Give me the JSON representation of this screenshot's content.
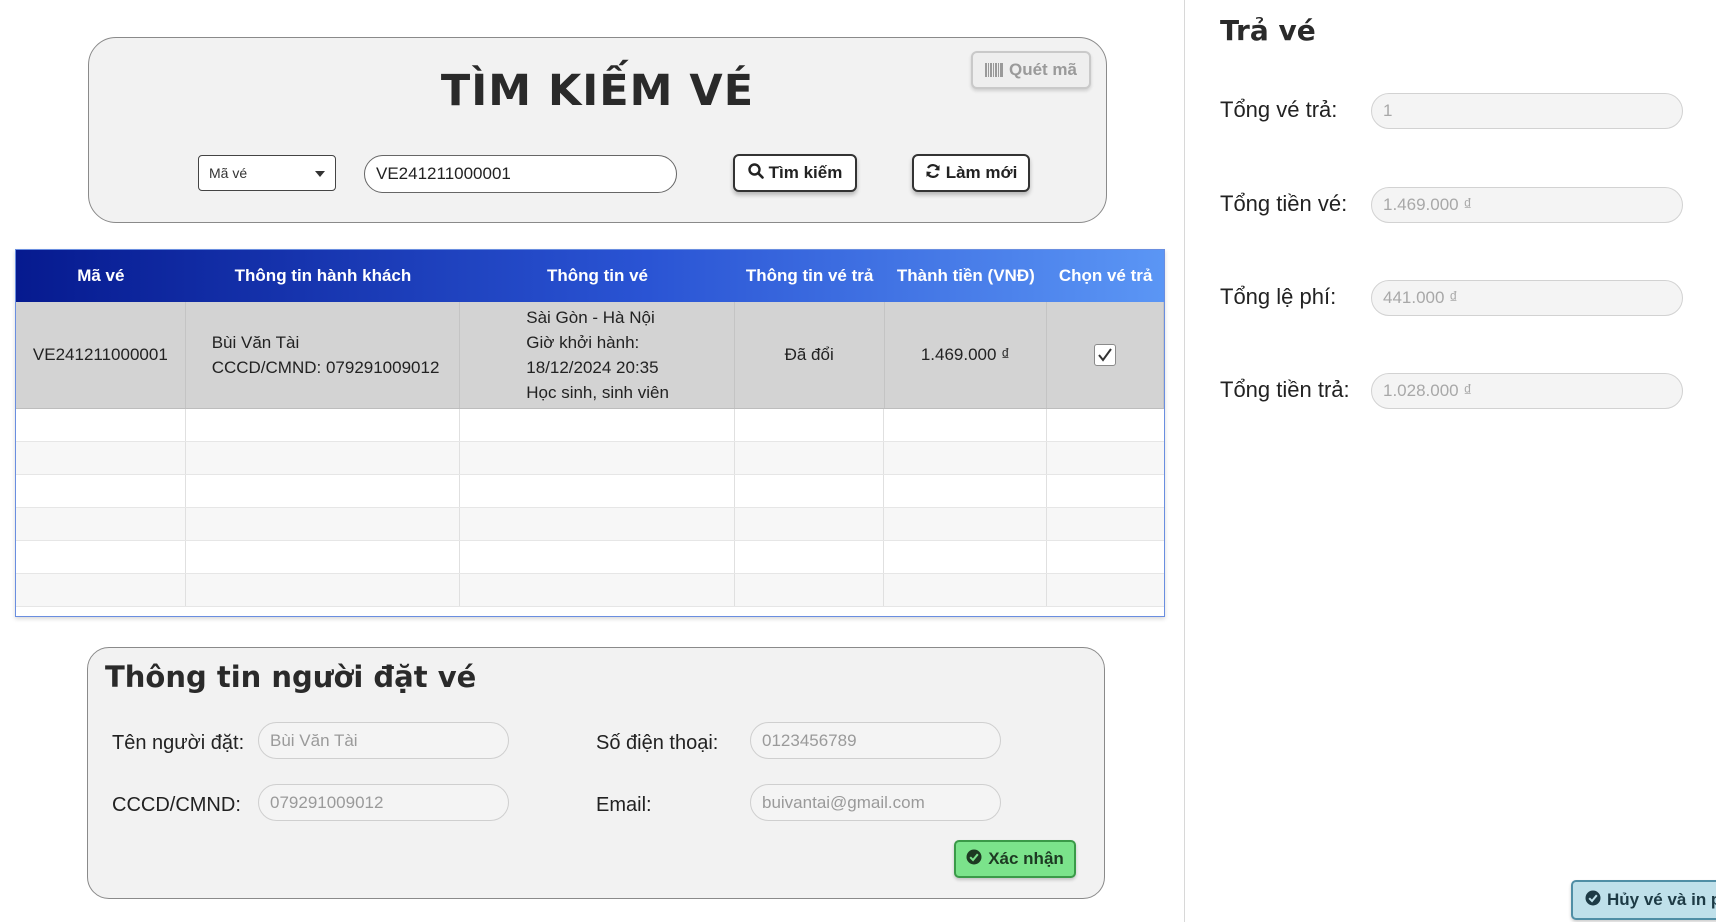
{
  "search": {
    "title": "TÌM KIẾM VÉ",
    "scan_label": "Quét mã",
    "type_selected": "Mã vé",
    "query_value": "VE241211000001",
    "find_label": "Tìm kiếm",
    "reset_label": "Làm mới"
  },
  "table": {
    "headers": [
      "Mã vé",
      "Thông tin hành khách",
      "Thông tin vé",
      "Thông tin vé trả",
      "Thành tiền (VNĐ)",
      "Chọn vé trả"
    ],
    "rows": [
      {
        "ticket_id": "VE241211000001",
        "passenger_name": "Bùi Văn Tài",
        "passenger_id": "CCCD/CMND: 079291009012",
        "route": "Sài Gòn - Hà Nội",
        "departure_label": "Giờ khởi hành:",
        "departure_time": "18/12/2024 20:35",
        "ticket_type": "Học sinh, sinh viên",
        "refund_status": "Đã đổi",
        "amount": "1.469.000 ₫",
        "selected": true
      }
    ]
  },
  "booker": {
    "title": "Thông tin người đặt vé",
    "name_label": "Tên người đặt:",
    "name_value": "Bùi Văn Tài",
    "phone_label": "Số điện thoại:",
    "phone_value": "0123456789",
    "id_label": "CCCD/CMND:",
    "id_value": "079291009012",
    "email_label": "Email:",
    "email_value": "buivantai@gmail.com",
    "confirm_label": "Xác nhận"
  },
  "refund": {
    "title": "Trả vé",
    "total_tickets_label": "Tổng vé trả:",
    "total_tickets_value": "1",
    "total_price_label": "Tổng tiền vé:",
    "total_price_value": "1.469.000 ₫",
    "total_fee_label": "Tổng lệ phí:",
    "total_fee_value": "441.000 ₫",
    "total_refund_label": "Tổng tiền trả:",
    "total_refund_value": "1.028.000 ₫",
    "cancel_print_label": "Hủy vé và in p"
  },
  "colors": {
    "header_gradient_start": "#061a8f",
    "header_gradient_end": "#5b96f5",
    "confirm_green": "#7be38b",
    "cancel_blue": "#bfe0ea"
  }
}
